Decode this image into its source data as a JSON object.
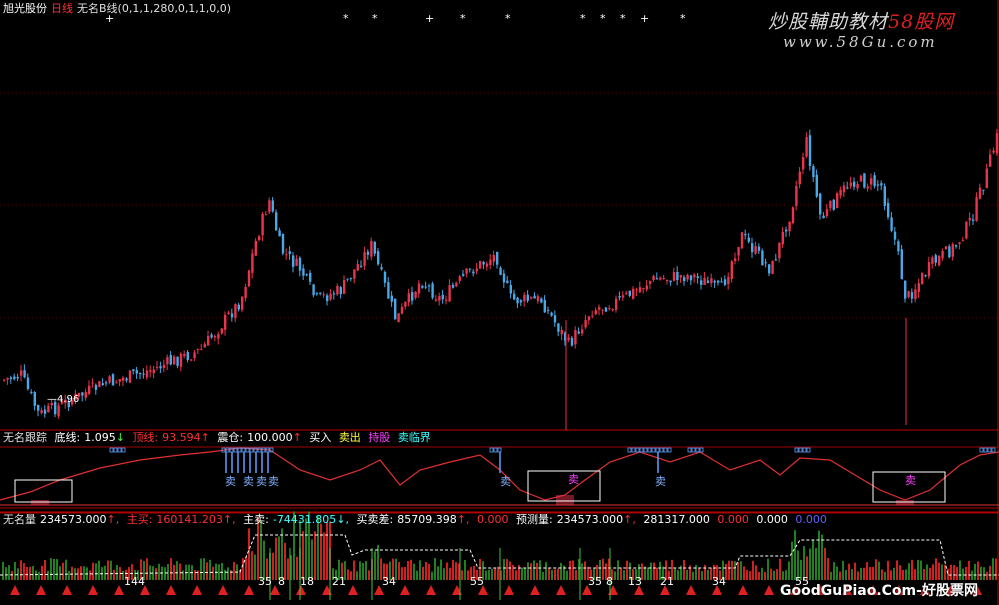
{
  "colors": {
    "up": "#e8344c",
    "down": "#4aa8e8",
    "grid": "#800000",
    "yellow": "#ffff40",
    "cyan": "#40ffff",
    "white": "#ffffff",
    "magenta": "#ff40ff",
    "green": "#30a030",
    "red": "#ff2020"
  },
  "main_header": {
    "stock_name": "旭光股份",
    "period": "日线",
    "indicator": "无名B线(0,1,1,280,0,1,1,0,0)"
  },
  "main_markers": [
    "+",
    "*",
    "*",
    "+",
    "*",
    "*",
    "*",
    "*",
    "*",
    "+",
    "*"
  ],
  "low_label": "4.96",
  "watermark": {
    "title_white": "炒股輔助教材",
    "title_red": "58股网",
    "url": "www.58Gu.com",
    "bottom": "GoodGuPiao.Com-好股票网"
  },
  "pane2_header": {
    "name": "无名跟踪",
    "bottom_label": "底线:",
    "bottom_value": "1.095",
    "item2_label": "顶线:",
    "item2_value": "93.594",
    "position_label": "震仓:",
    "position_value": "100.000",
    "buy_label": "买入",
    "sell_label": "卖出",
    "item6": "持股",
    "item7": "卖临界"
  },
  "pane2_sell_labels": [
    "卖",
    "卖",
    "卖",
    "卖",
    "卖",
    "卖",
    "卖"
  ],
  "pane3_header": {
    "name": "无名量",
    "v1": "234573.000",
    "main_buy_label": "主买:",
    "main_buy": "160141.203",
    "main_sell_label": "主卖:",
    "main_sell": "-74431.805",
    "diff_label": "买卖差:",
    "diff": "85709.398",
    "v5": "0.000",
    "forecast_label": "预测量:",
    "forecast": "234573.000",
    "v7": "281317.000",
    "v8": "0.000",
    "v9": "0.000",
    "v10": "0.000"
  },
  "pane3_numbers": [
    "144",
    "35",
    "8",
    "18",
    "21",
    "34",
    "55",
    "35",
    "8",
    "13",
    "21",
    "34",
    "55"
  ]
}
